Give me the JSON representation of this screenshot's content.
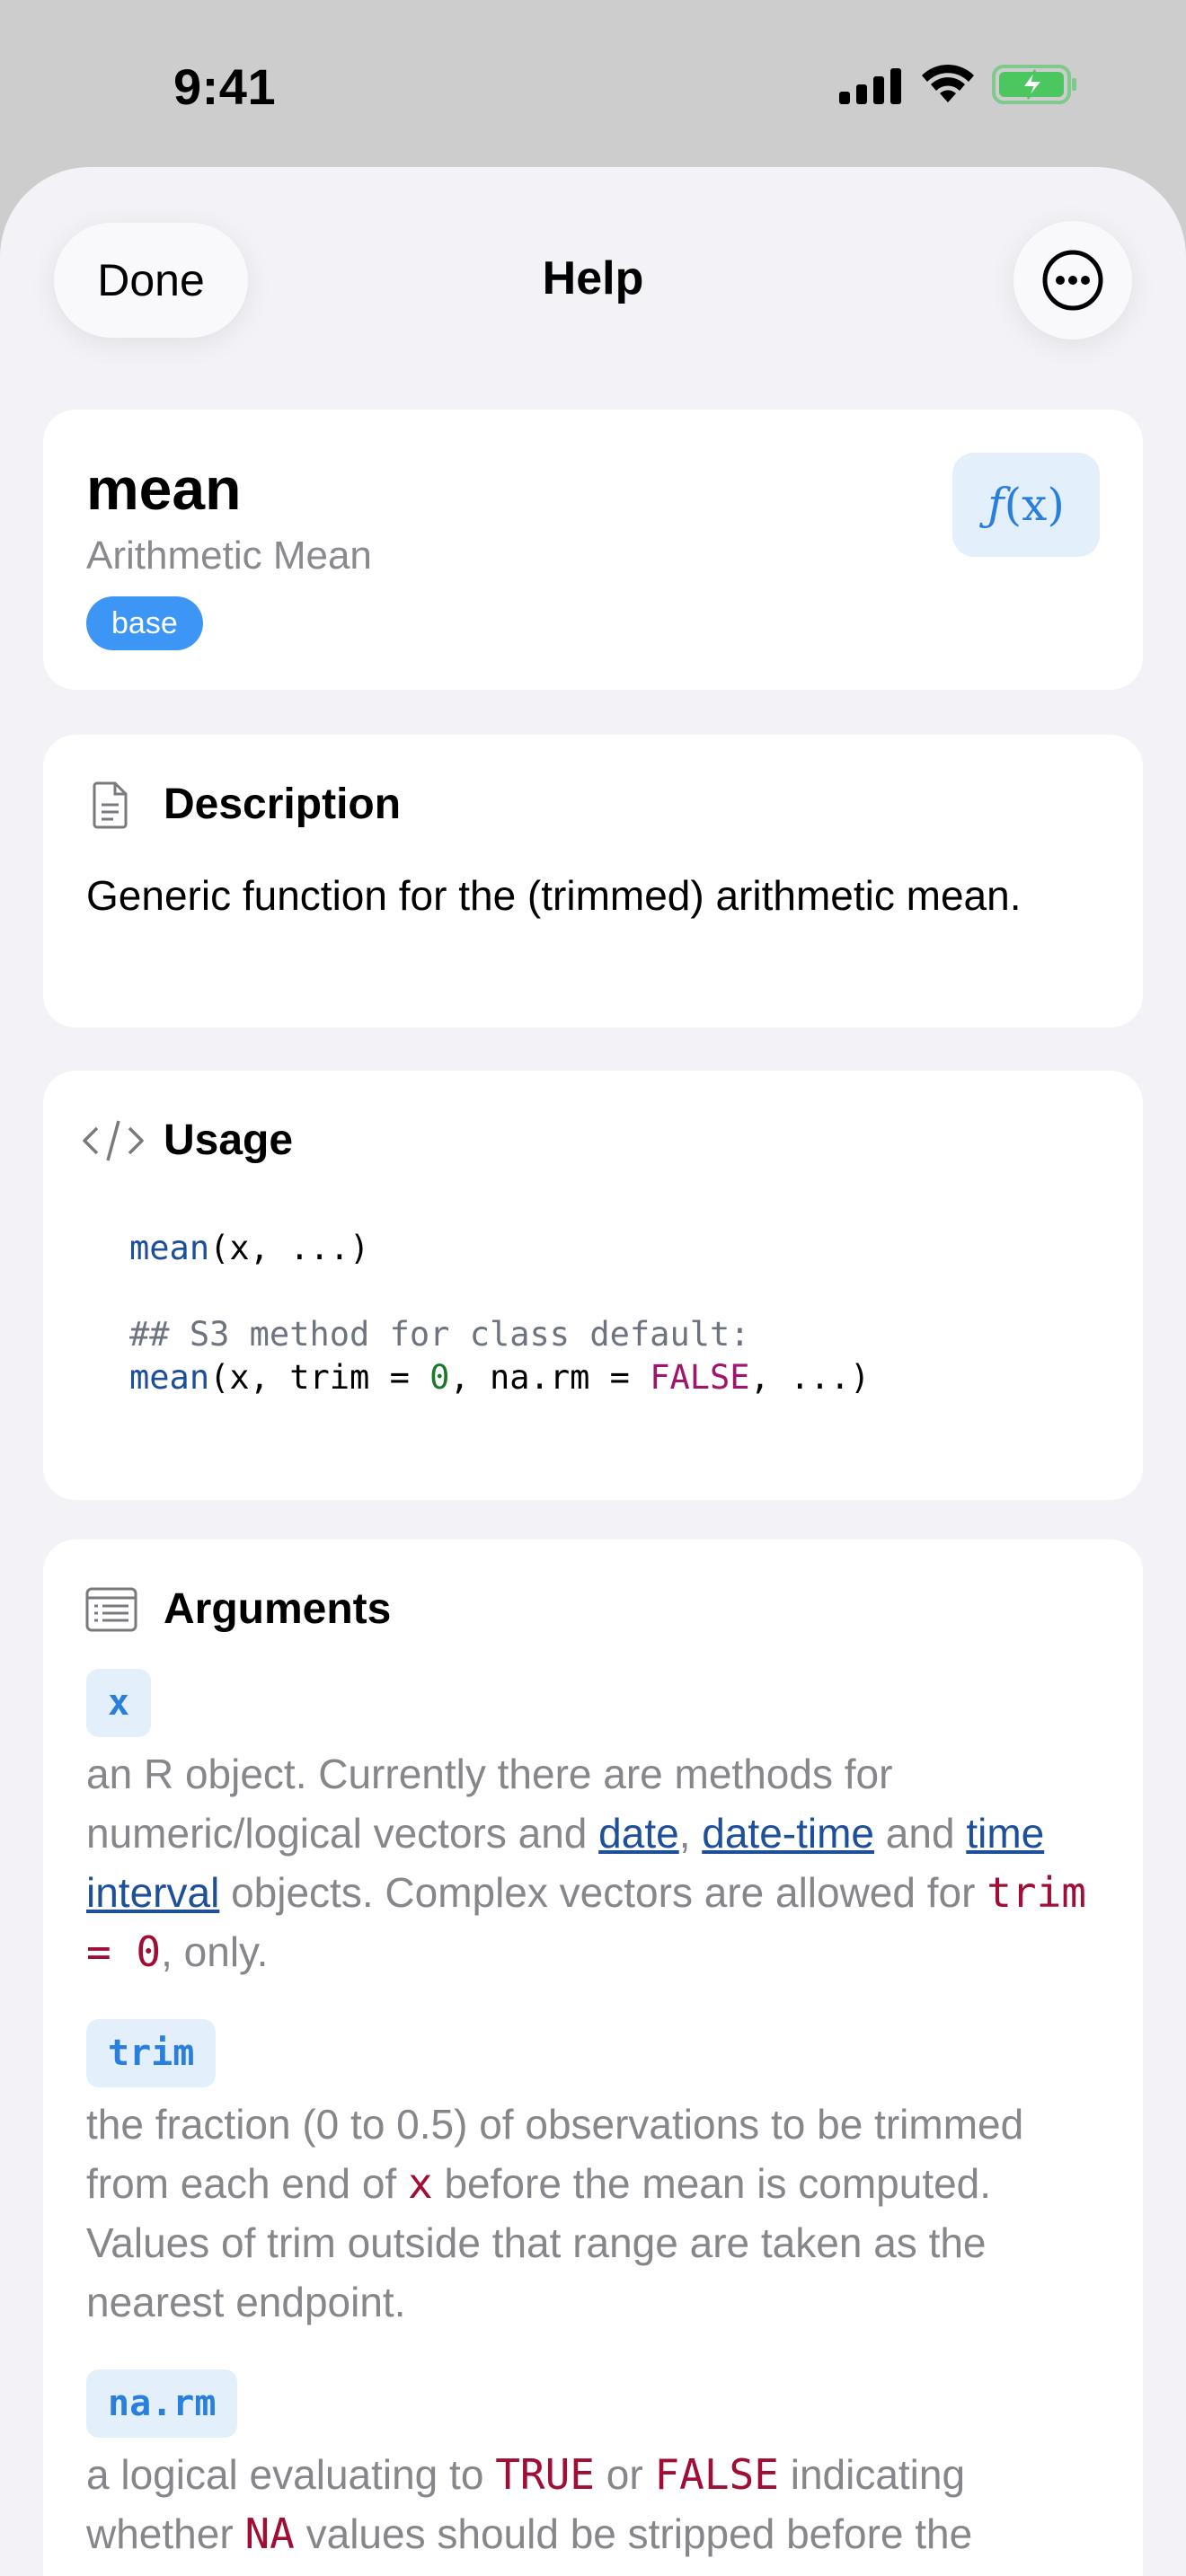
{
  "status_bar": {
    "time": "9:41"
  },
  "nav": {
    "done_label": "Done",
    "title": "Help",
    "more_icon": "ellipsis-circle-icon"
  },
  "header": {
    "name": "mean",
    "title": "Arithmetic Mean",
    "package": "base",
    "fx_label": "(x)"
  },
  "description": {
    "heading": "Description",
    "text": "Generic function for the (trimmed) arithmetic mean."
  },
  "usage": {
    "heading": "Usage",
    "line1_fn": "mean",
    "line1_args": "(x, ...)",
    "comment": "## S3 method for class default:",
    "line2_fn": "mean",
    "line2_a": "(x, trim = ",
    "line2_num": "0",
    "line2_b": ", na.rm = ",
    "line2_kw": "FALSE",
    "line2_c": ", ...)"
  },
  "arguments": {
    "heading": "Arguments",
    "items": [
      {
        "name": "x",
        "text1": "an R object. Currently there are methods for numeric/logical vectors and ",
        "link1": "date",
        "sep1": ", ",
        "link2": "date-time",
        "text2": " and ",
        "link3": "time interval",
        "text3": " objects. Complex vectors are allowed for ",
        "code1": "trim = 0",
        "text4": ", only."
      },
      {
        "name": "trim",
        "text1": "the fraction (0 to 0.5) of observations to be trimmed from each end of ",
        "code1": "x",
        "text2": " before the mean is computed. Values of trim outside that range are taken as the nearest endpoint."
      },
      {
        "name": "na.rm",
        "text1": "a logical evaluating to ",
        "code1": "TRUE",
        "text2": " or ",
        "code2": "FALSE",
        "text3": " indicating whether ",
        "code3": "NA",
        "text4": " values should be stripped before the"
      }
    ]
  }
}
